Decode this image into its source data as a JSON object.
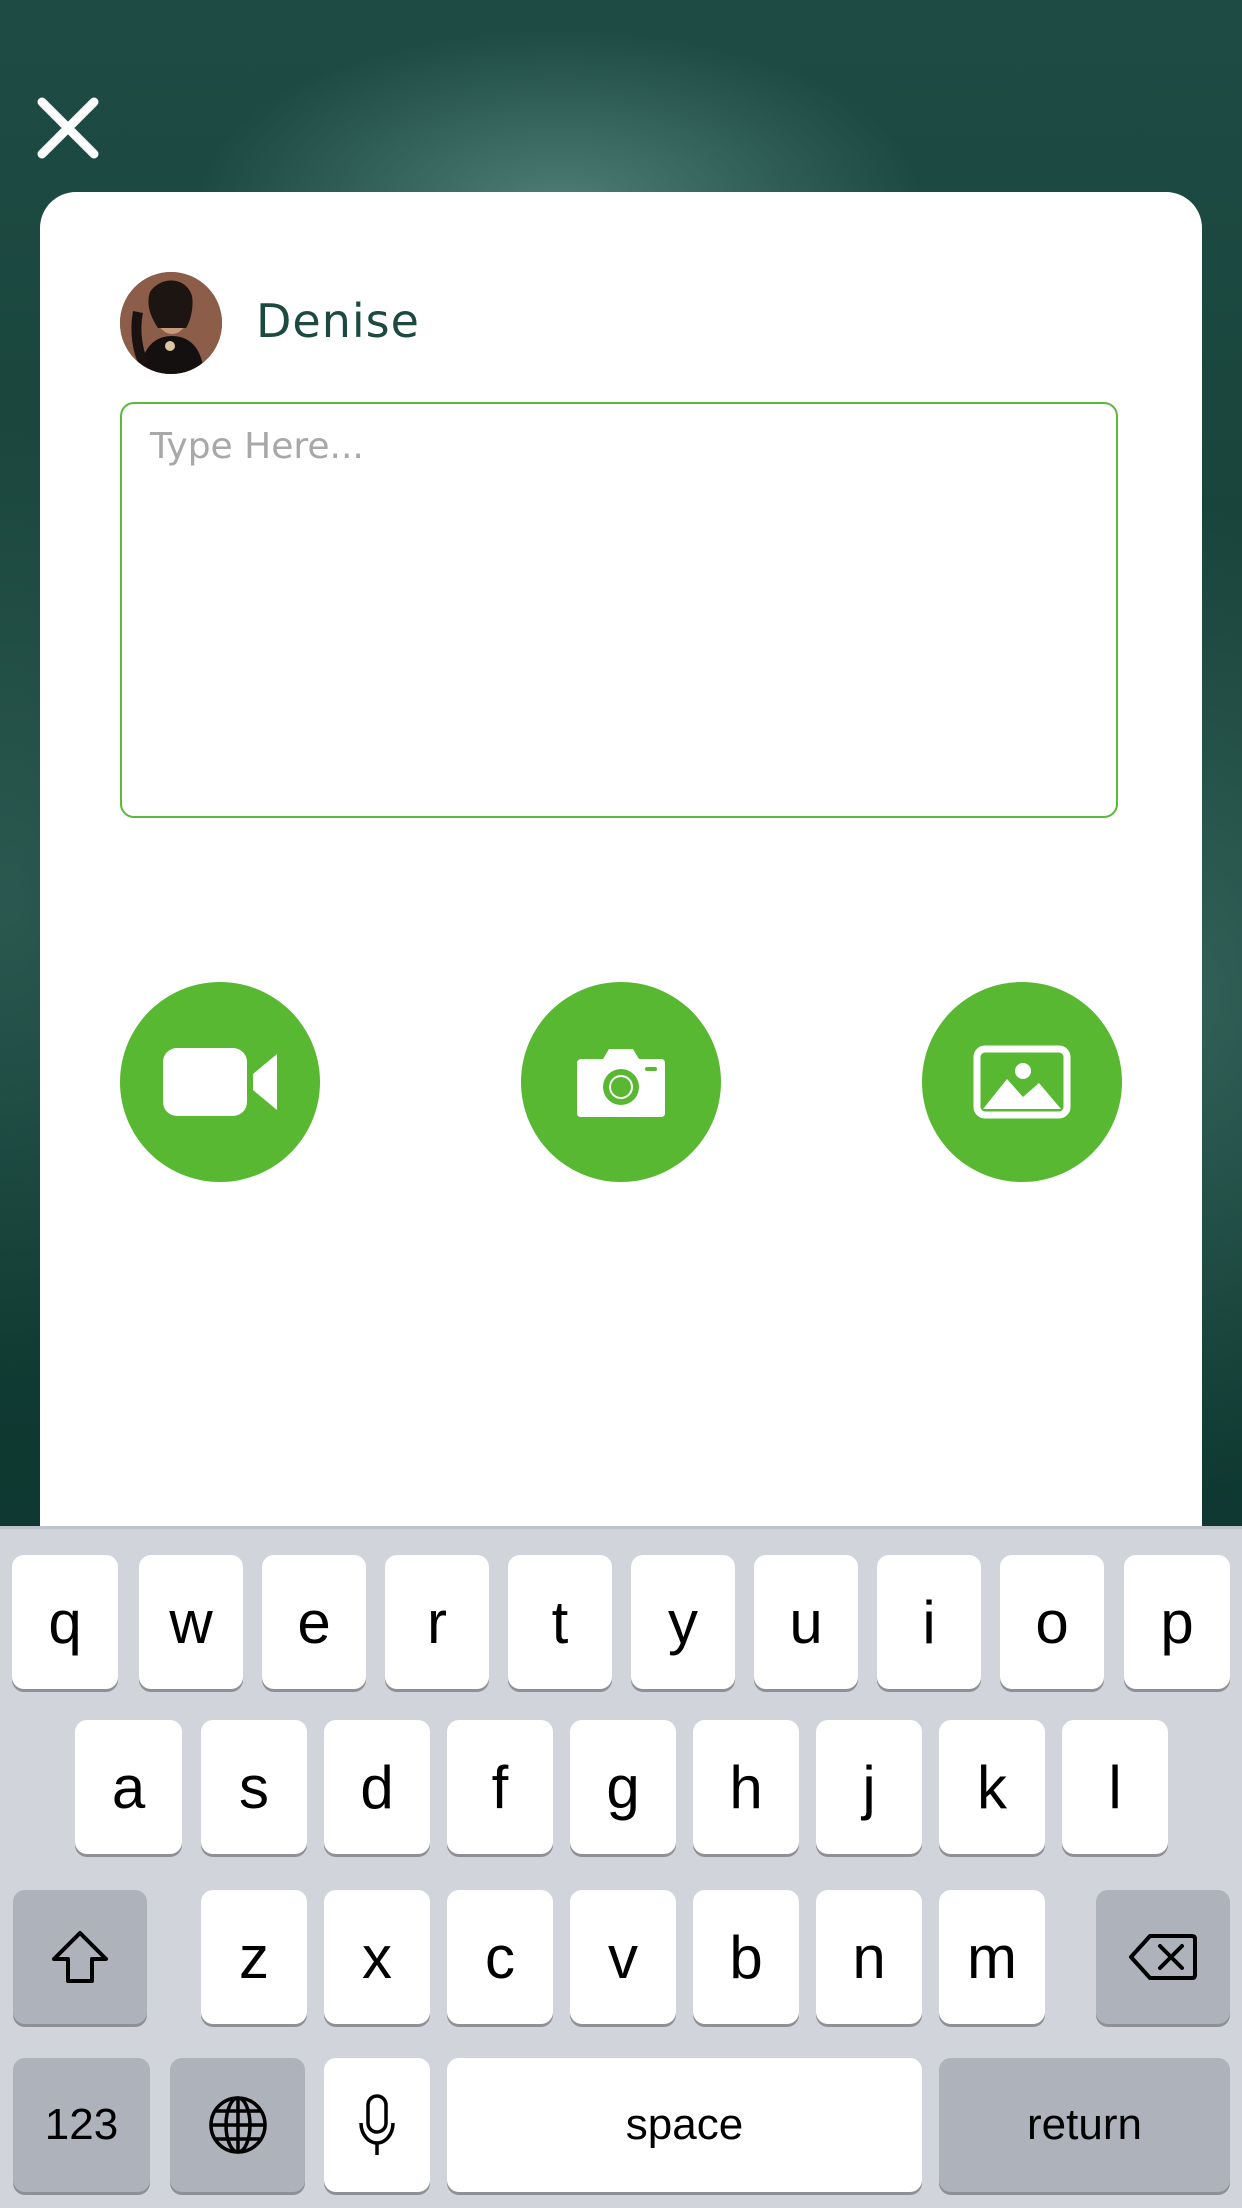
{
  "header": {
    "close_icon": "close-icon"
  },
  "composer": {
    "username": "Denise",
    "placeholder": "Type Here...",
    "accent_color": "#58b832",
    "media_buttons": [
      {
        "name": "video",
        "icon": "video-camera-icon"
      },
      {
        "name": "camera",
        "icon": "camera-icon"
      },
      {
        "name": "gallery",
        "icon": "image-icon"
      }
    ]
  },
  "keyboard": {
    "row1": [
      "q",
      "w",
      "e",
      "r",
      "t",
      "y",
      "u",
      "i",
      "o",
      "p"
    ],
    "row2": [
      "a",
      "s",
      "d",
      "f",
      "g",
      "h",
      "j",
      "k",
      "l"
    ],
    "row3": [
      "z",
      "x",
      "c",
      "v",
      "b",
      "n",
      "m"
    ],
    "numbers_key": "123",
    "space_key": "space",
    "return_key": "return",
    "shift_icon": "shift-icon",
    "delete_icon": "backspace-icon",
    "globe_icon": "globe-icon",
    "mic_icon": "microphone-icon"
  }
}
